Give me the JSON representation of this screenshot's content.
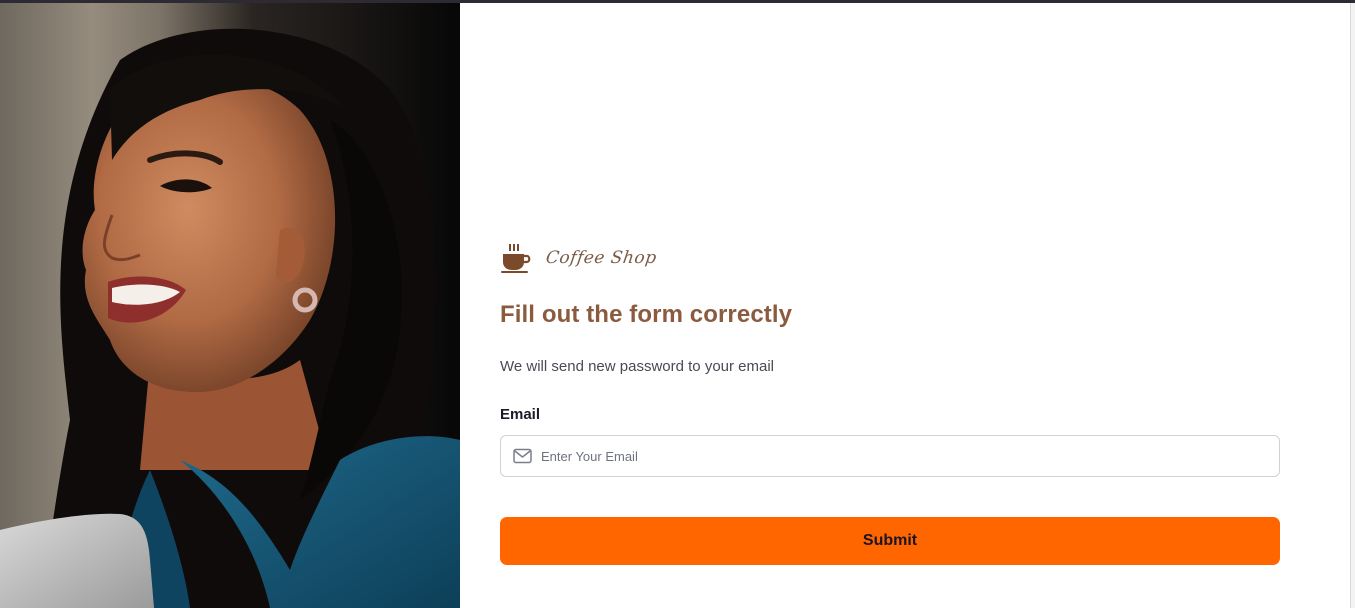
{
  "brand": {
    "name": "Coffee Shop",
    "icon": "coffee-cup-icon"
  },
  "form": {
    "title": "Fill out the form correctly",
    "subtitle": "We will send new password to your email",
    "email_label": "Email",
    "email_placeholder": "Enter Your Email",
    "email_value": "",
    "email_icon": "envelope-icon",
    "submit_label": "Submit"
  },
  "photo": {
    "description_icon": "hero-photo"
  },
  "colors": {
    "accent": "#ff6600",
    "title": "#8a5b3e",
    "brand": "#7b5a44"
  }
}
